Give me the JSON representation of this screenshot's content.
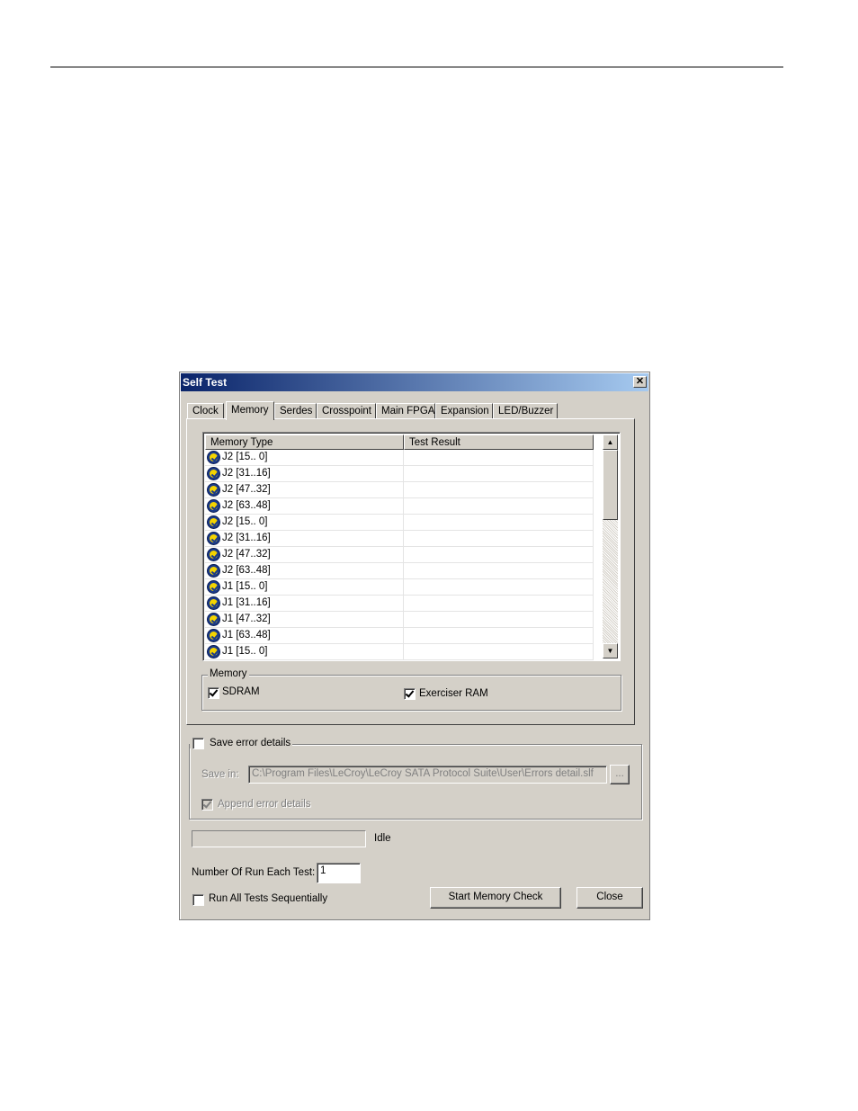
{
  "window": {
    "title": "Self Test",
    "close_glyph": "✕"
  },
  "tabs": [
    {
      "label": "Clock",
      "active": false
    },
    {
      "label": "Memory",
      "active": true
    },
    {
      "label": "Serdes",
      "active": false
    },
    {
      "label": "Crosspoint",
      "active": false
    },
    {
      "label": "Main FPGA",
      "active": false
    },
    {
      "label": "Expansion",
      "active": false
    },
    {
      "label": "LED/Buzzer",
      "active": false
    }
  ],
  "memory_list": {
    "columns": [
      "Memory Type",
      "Test Result"
    ],
    "rows": [
      {
        "type": "J2 [15.. 0]",
        "result": "",
        "icon": "check-icon"
      },
      {
        "type": "J2 [31..16]",
        "result": "",
        "icon": "check-icon"
      },
      {
        "type": "J2 [47..32]",
        "result": "",
        "icon": "check-icon"
      },
      {
        "type": "J2 [63..48]",
        "result": "",
        "icon": "check-icon"
      },
      {
        "type": "J2 [15.. 0]",
        "result": "",
        "icon": "check-icon"
      },
      {
        "type": "J2 [31..16]",
        "result": "",
        "icon": "check-icon"
      },
      {
        "type": "J2 [47..32]",
        "result": "",
        "icon": "check-icon"
      },
      {
        "type": "J2 [63..48]",
        "result": "",
        "icon": "check-icon"
      },
      {
        "type": "J1 [15.. 0]",
        "result": "",
        "icon": "check-icon"
      },
      {
        "type": "J1 [31..16]",
        "result": "",
        "icon": "check-icon"
      },
      {
        "type": "J1 [47..32]",
        "result": "",
        "icon": "check-icon"
      },
      {
        "type": "J1 [63..48]",
        "result": "",
        "icon": "check-icon"
      },
      {
        "type": "J1 [15.. 0]",
        "result": "",
        "icon": "check-icon"
      }
    ],
    "scroll_up_glyph": "▲",
    "scroll_down_glyph": "▼"
  },
  "memory_group": {
    "legend": "Memory",
    "sdram_label": "SDRAM",
    "sdram_checked": true,
    "exerciser_label": "Exerciser RAM",
    "exerciser_checked": true
  },
  "save_errors": {
    "label": "Save error details",
    "checked": false,
    "save_in_label": "Save in:",
    "save_in_value": "C:\\Program Files\\LeCroy\\LeCroy SATA Protocol Suite\\User\\Errors detail.slf",
    "browse_label": "...",
    "append_label": "Append error details",
    "append_checked": true
  },
  "status": {
    "text": "Idle",
    "progress": 0
  },
  "run_count": {
    "label": "Number Of Run Each Test:",
    "value": "1"
  },
  "run_all": {
    "label": "Run All Tests Sequentially",
    "checked": false
  },
  "buttons": {
    "start": "Start Memory Check",
    "close": "Close"
  }
}
